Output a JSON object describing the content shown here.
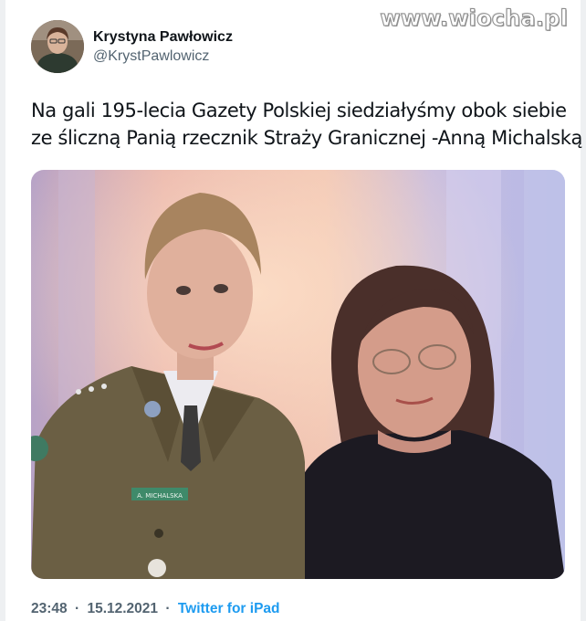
{
  "watermark": "www.wiocha.pl",
  "author": {
    "display_name": "Krystyna Pawłowicz",
    "handle": "@KrystPawlowicz"
  },
  "tweet": {
    "text_lines": [
      "Na gali 195-lecia Gazety Polskiej siedziałyśmy obok siebie",
      "ze śliczną Panią rzecznik Straży Granicznej -Anną Michalską"
    ],
    "photo_nametag": "A. MICHALSKA"
  },
  "meta": {
    "time": "23:48",
    "separator": "·",
    "date": "15.12.2021",
    "source": "Twitter for iPad"
  },
  "colors": {
    "text": "#0f1419",
    "secondary": "#536471",
    "link": "#1d9bf0"
  },
  "icons": [
    "profile-avatar",
    "tweet-photo"
  ]
}
